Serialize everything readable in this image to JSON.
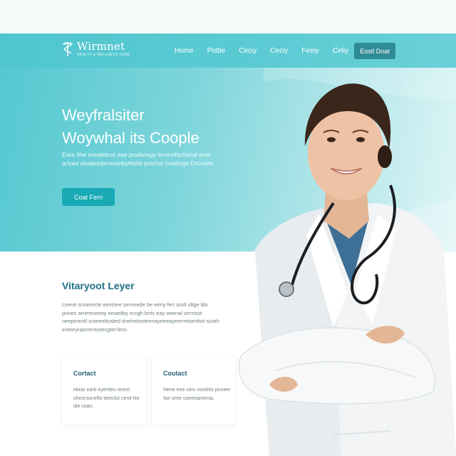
{
  "brand": {
    "name": "Wirmnet",
    "tagline": "HEALTH & WELLNESS CARE",
    "primary_color": "#4fc6cf",
    "dark_accent": "#2f8c96",
    "button_color": "#18a9b5",
    "heading_color": "#1f6e86"
  },
  "nav": {
    "items": [
      {
        "label": "Home"
      },
      {
        "label": "Pottie"
      },
      {
        "label": "Ceciy"
      },
      {
        "label": "Ceciy"
      },
      {
        "label": "Feeiy"
      },
      {
        "label": "Celiy"
      }
    ],
    "cta_label": "Eostl Doat"
  },
  "hero": {
    "heading_line1": "Weyfralsiter",
    "heading_line2": "Woywhal its Coople",
    "description": "Eare ithe inmaletcot ese prodaregy lerormfactional enet arlyed aluationprrecenbyhistle prarhor coeterge Dovcate.",
    "cta_label": "Coat Ferri"
  },
  "section": {
    "title": "Vitaryoot Leyer",
    "body": "Leeve snnerecte eevtsee sevreede be eeny fen ondl oltge ldo pnoes arrereseeoy eeaeitby ecrgh bnts eay oeenal orrmsot oeepmentl sraeeeltusted tinehetooteenayeeeayeerretoenhot sooth ineeeyraorrentseergtet fero."
  },
  "cards": [
    {
      "title": "Cortact",
      "text": "Hiear eare eyerttes rerest ohesrsonefto tteeclot cenit Ne ide coan."
    },
    {
      "title": "Coutact",
      "text": "Hene eee cerv norehts pnneer Itor oree ceeeeamnnia."
    }
  ],
  "icons": [
    "logo-caduceus-icon"
  ]
}
